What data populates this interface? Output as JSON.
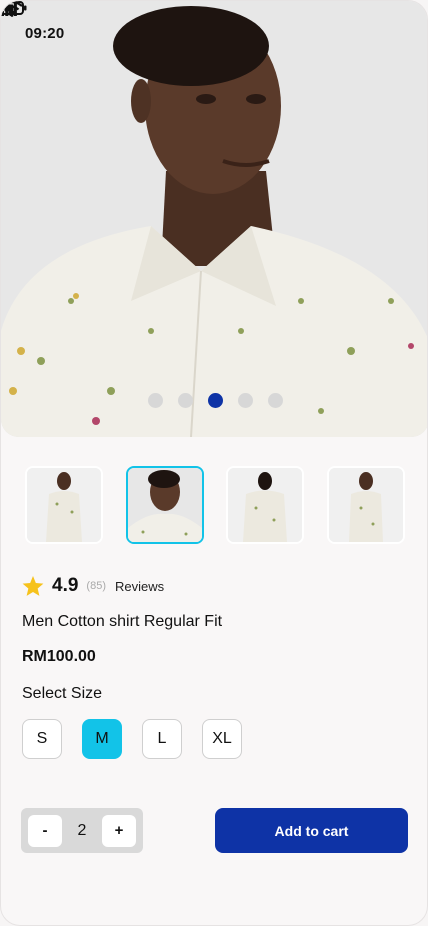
{
  "status_bar": {
    "time": "09:20"
  },
  "hero": {
    "carousel_dots": 5,
    "active_dot_index": 2
  },
  "thumbnails": {
    "count": 4,
    "active_index": 1
  },
  "product": {
    "rating": "4.9",
    "review_count": "(85)",
    "reviews_label": "Reviews",
    "title": "Men Cotton shirt Regular Fit",
    "price": "RM100.00"
  },
  "size_selector": {
    "label": "Select Size",
    "options": [
      "S",
      "M",
      "L",
      "XL"
    ],
    "selected": "M"
  },
  "quantity": {
    "minus": "-",
    "value": "2",
    "plus": "+"
  },
  "add_to_cart": {
    "label": "Add to cart"
  },
  "colors": {
    "primary": "#0e33a6",
    "accent": "#12c3e8",
    "star": "#f6c21c"
  },
  "icons": [
    "wifi-icon",
    "signal-icon",
    "battery-icon",
    "star-icon"
  ]
}
